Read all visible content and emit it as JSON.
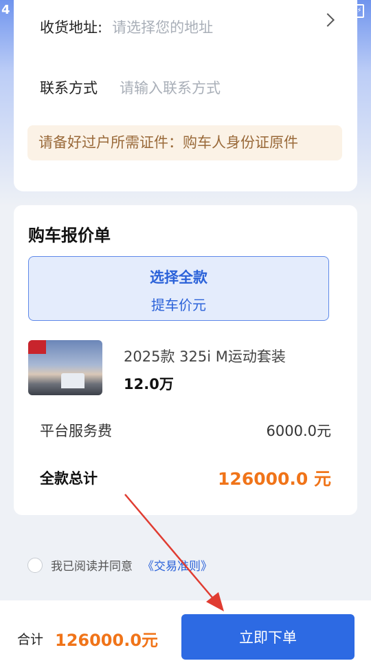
{
  "status": {
    "left_text": "4",
    "right_icon": "battery-icon"
  },
  "address": {
    "label": "收货地址:",
    "placeholder": "请选择您的地址"
  },
  "contact": {
    "label": "联系方式",
    "placeholder": "请输入联系方式"
  },
  "notice": "请备好过户所需证件：购车人身份证原件",
  "quote": {
    "title": "购车报价单",
    "option_title": "选择全款",
    "option_subtitle": "提车价元",
    "car_name": "2025款 325i M运动套装",
    "car_price": "12.0万",
    "fee_label": "平台服务费",
    "fee_value": "6000.0元",
    "total_label": "全款总计",
    "total_value": "126000.0 元"
  },
  "agreement": {
    "text": "我已阅读并同意",
    "link": "《交易准则》"
  },
  "bottom": {
    "sum_label": "合计",
    "sum_value": "126000.0元",
    "order_button": "立即下单"
  },
  "colors": {
    "accent_blue": "#2d6ae3",
    "price_orange": "#f07419",
    "annotation_red": "#e03c31"
  }
}
